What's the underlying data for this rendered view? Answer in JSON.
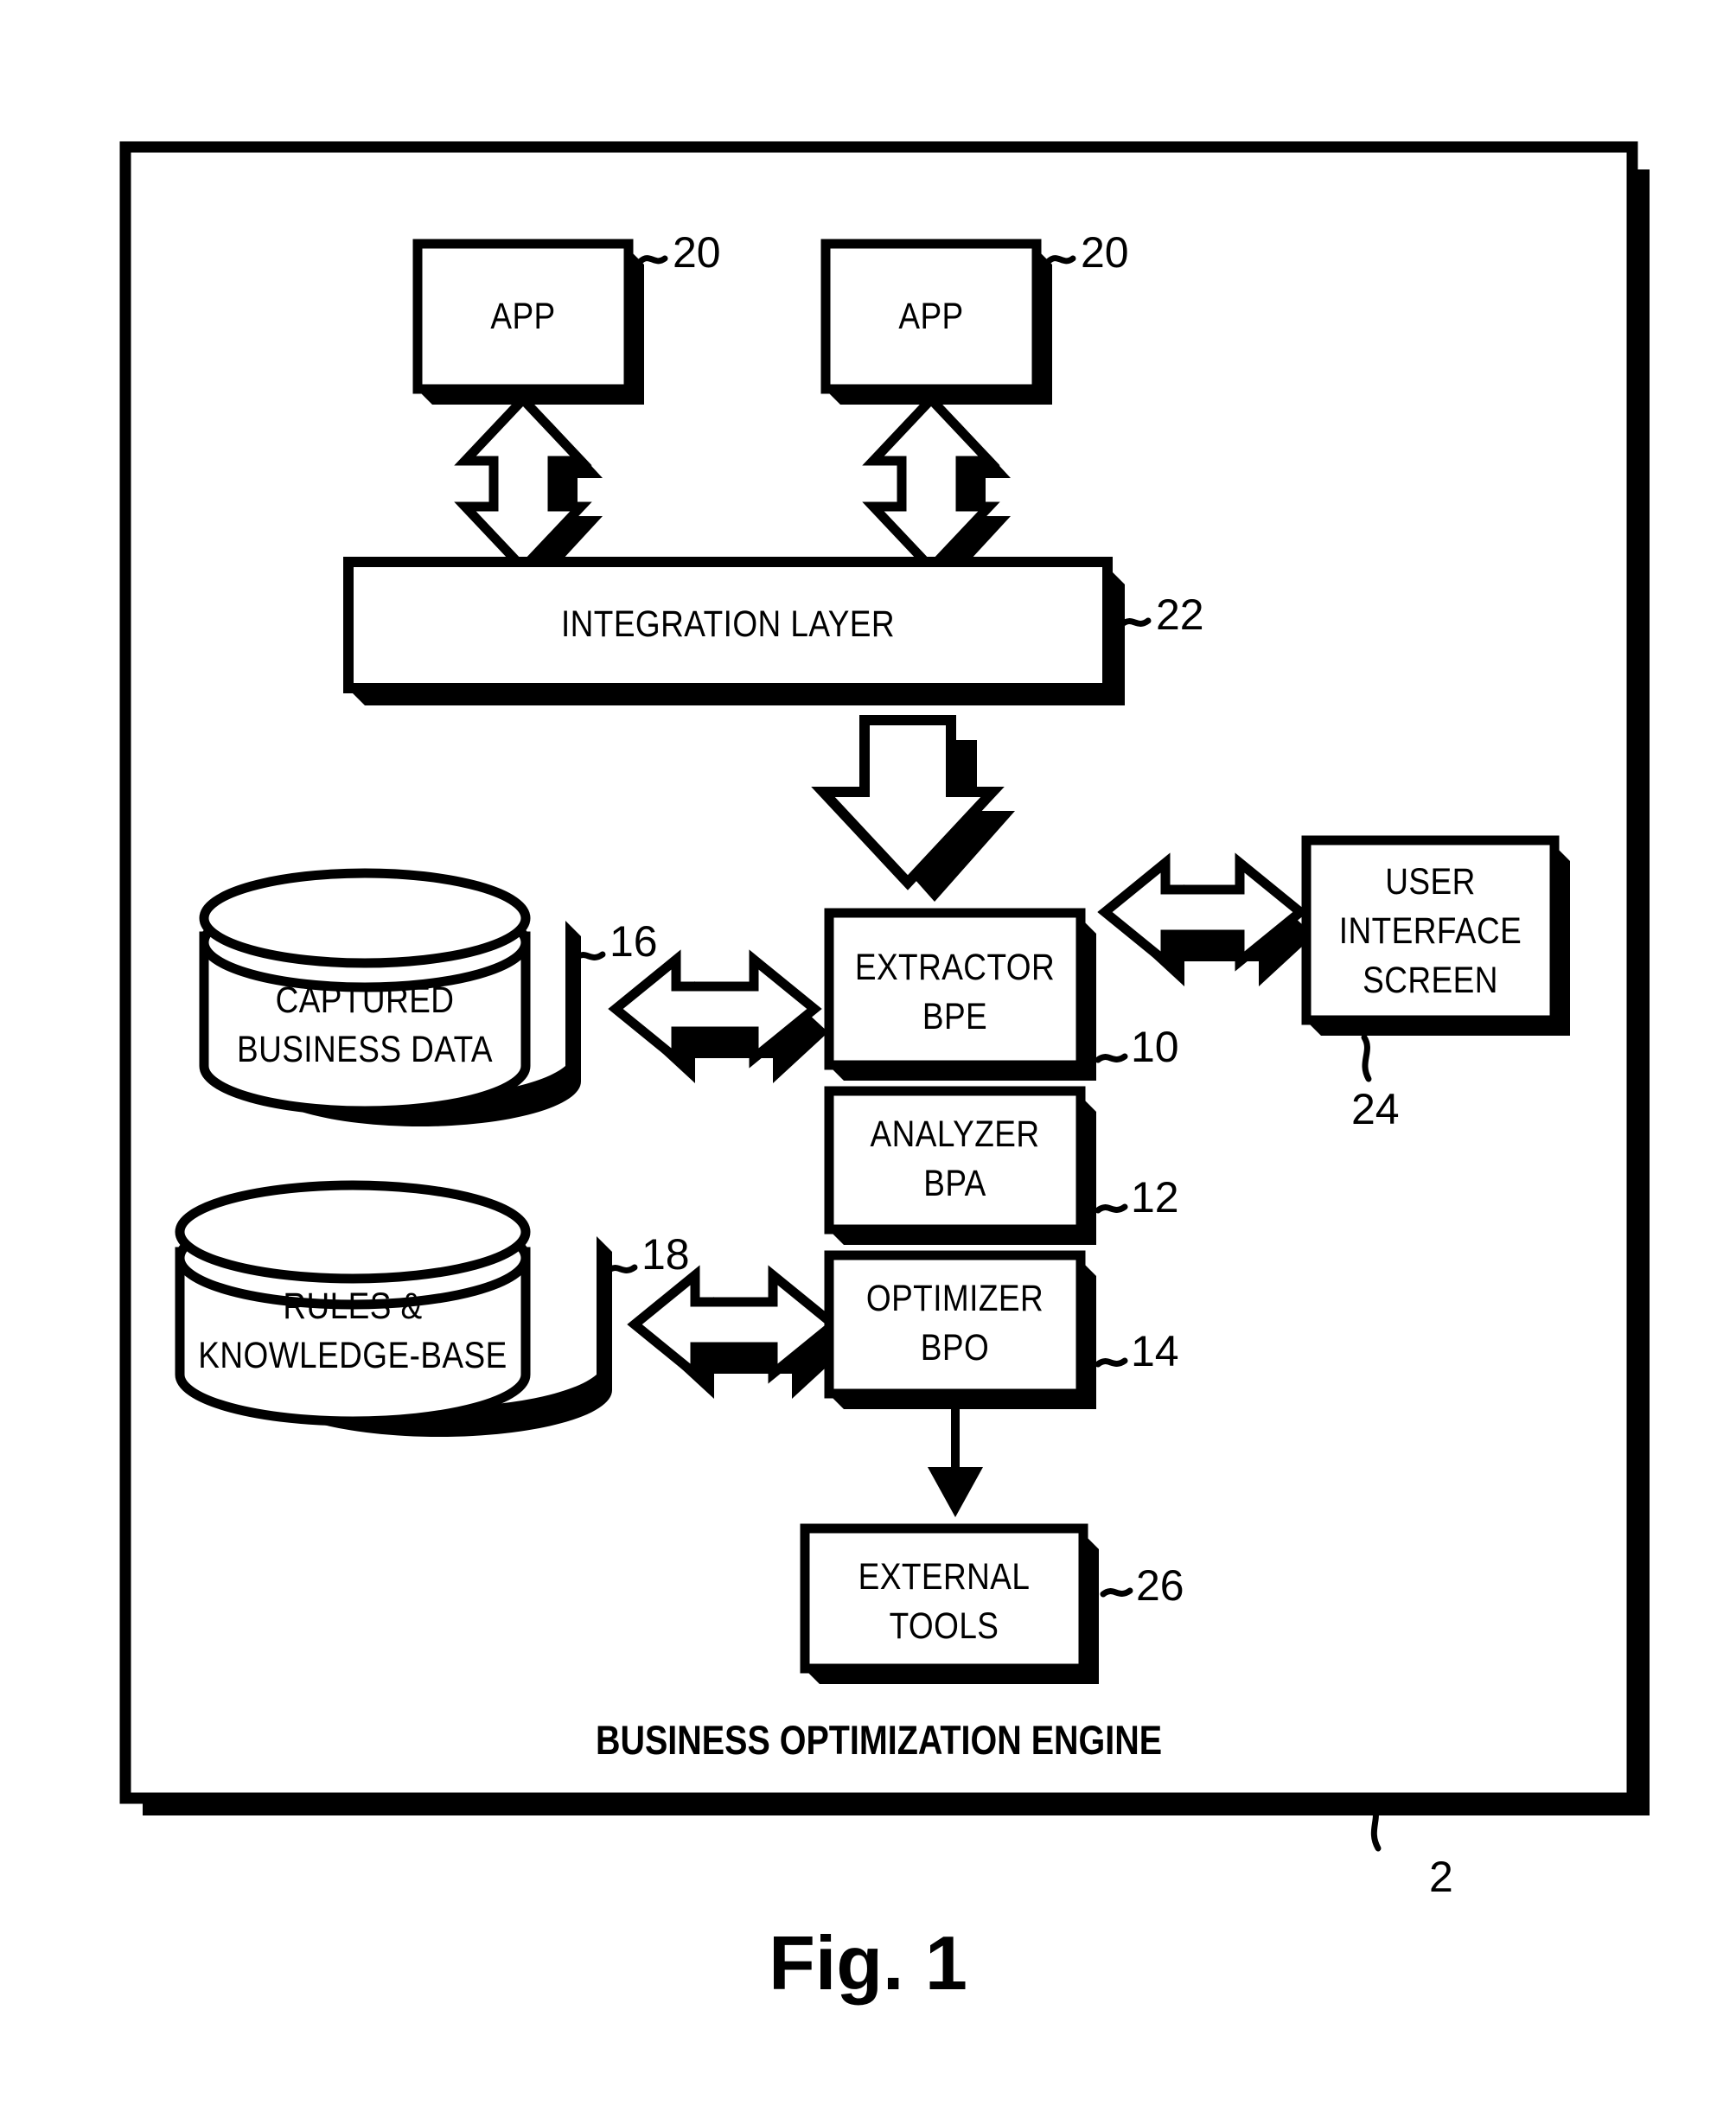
{
  "figure": {
    "caption": "Fig. 1",
    "frame_label": "BUSINESS OPTIMIZATION ENGINE",
    "frame_ref": "2",
    "line_color": "#000000",
    "background": "#ffffff"
  },
  "nodes": {
    "app_left": {
      "label": "APP",
      "ref": "20"
    },
    "app_right": {
      "label": "APP",
      "ref": "20"
    },
    "integration_layer": {
      "label": "INTEGRATION LAYER",
      "ref": "22"
    },
    "captured_business_data": {
      "label_line1": "CAPTURED",
      "label_line2": "BUSINESS DATA",
      "ref": "16"
    },
    "rules_knowledge_base": {
      "label_line1": "RULES &",
      "label_line2": "KNOWLEDGE-BASE",
      "ref": "18"
    },
    "extractor": {
      "label_line1": "EXTRACTOR",
      "label_line2": "BPE",
      "ref": "10"
    },
    "analyzer": {
      "label_line1": "ANALYZER",
      "label_line2": "BPA",
      "ref": "12"
    },
    "optimizer": {
      "label_line1": "OPTIMIZER",
      "label_line2": "BPO",
      "ref": "14"
    },
    "user_interface_screen": {
      "label_line1": "USER",
      "label_line2": "INTERFACE",
      "label_line3": "SCREEN",
      "ref": "24"
    },
    "external_tools": {
      "label_line1": "EXTERNAL",
      "label_line2": "TOOLS",
      "ref": "26"
    }
  },
  "connectors": [
    {
      "name": "app-left-to-integration",
      "kind": "double-arrow-vertical"
    },
    {
      "name": "app-right-to-integration",
      "kind": "double-arrow-vertical"
    },
    {
      "name": "integration-to-extractor",
      "kind": "block-arrow-down"
    },
    {
      "name": "captured-data-to-extractor",
      "kind": "double-arrow-horizontal"
    },
    {
      "name": "rules-to-optimizer",
      "kind": "double-arrow-horizontal"
    },
    {
      "name": "extractor-to-ui-screen",
      "kind": "double-arrow-horizontal"
    },
    {
      "name": "optimizer-to-external-tools",
      "kind": "line-arrow-down"
    }
  ]
}
